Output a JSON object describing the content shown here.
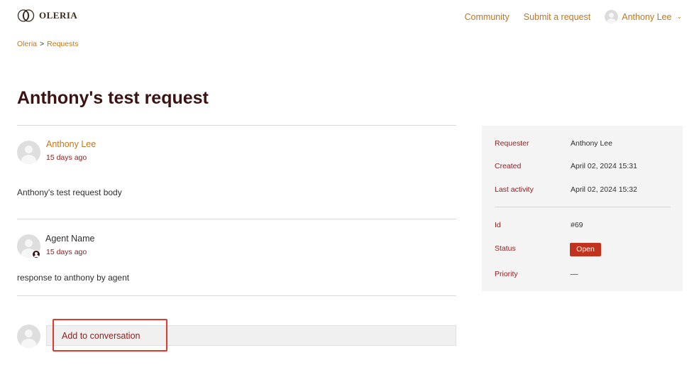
{
  "header": {
    "logo_text": "OLERIA",
    "nav": {
      "community": "Community",
      "submit_request": "Submit a request",
      "user_name": "Anthony Lee"
    }
  },
  "breadcrumb": {
    "items": [
      "Oleria",
      "Requests"
    ],
    "separator": ">"
  },
  "request": {
    "title": "Anthony's test request"
  },
  "comments": [
    {
      "author": "Anthony Lee",
      "time": "15 days ago",
      "body": "Anthony's test request body"
    },
    {
      "author": "Agent Name",
      "time": "15 days ago",
      "body": "response to anthony by agent"
    }
  ],
  "reply": {
    "placeholder": "Add to conversation"
  },
  "sidebar": {
    "requester_label": "Requester",
    "requester_value": "Anthony Lee",
    "created_label": "Created",
    "created_value": "April 02, 2024 15:31",
    "last_activity_label": "Last activity",
    "last_activity_value": "April 02, 2024 15:32",
    "id_label": "Id",
    "id_value": "#69",
    "status_label": "Status",
    "status_value": "Open",
    "priority_label": "Priority",
    "priority_value": "—"
  },
  "colors": {
    "accent": "#c0771c",
    "title": "#3c1313",
    "label": "#8a1e1e",
    "status_open": "#c1331f",
    "highlight": "#e23b2e"
  }
}
